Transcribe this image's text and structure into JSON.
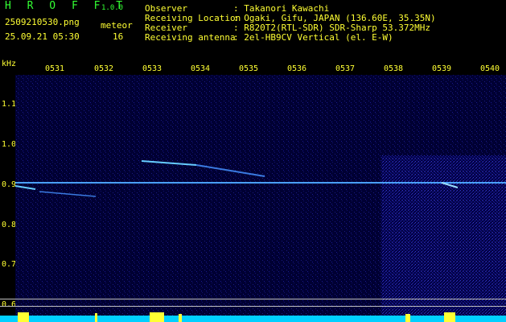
{
  "app": {
    "name": "H R O F F T",
    "version": "1.0.0"
  },
  "file": {
    "name": "2509210530.png",
    "datetime": "25.09.21 05:30"
  },
  "meteor": {
    "label": "meteor",
    "count": "16"
  },
  "info": {
    "observer_label": "Observer",
    "observer_value": ": Takanori Kawachi",
    "location_label": "Receiving Location",
    "location_value": ": Ogaki, Gifu, JAPAN (136.60E, 35.35N)",
    "receiver_label": "Receiver",
    "receiver_value": ": R820T2(RTL-SDR) SDR-Sharp 53.372MHz",
    "antenna_label": "Receiving antenna",
    "antenna_value": ": 2el-HB9CV Vertical (el. E-W)"
  },
  "axis": {
    "unit": "kHz",
    "time_ticks": [
      "0531",
      "0532",
      "0533",
      "0534",
      "0535",
      "0536",
      "0537",
      "0538",
      "0539",
      "0540"
    ],
    "freq_ticks": [
      "1.1",
      "1.0",
      "0.9",
      "0.8",
      "0.7",
      "0.6"
    ]
  },
  "colors": {
    "background": "#000033",
    "label": "#ffff33",
    "title": "#33ff33",
    "signal": "#66ccff"
  }
}
